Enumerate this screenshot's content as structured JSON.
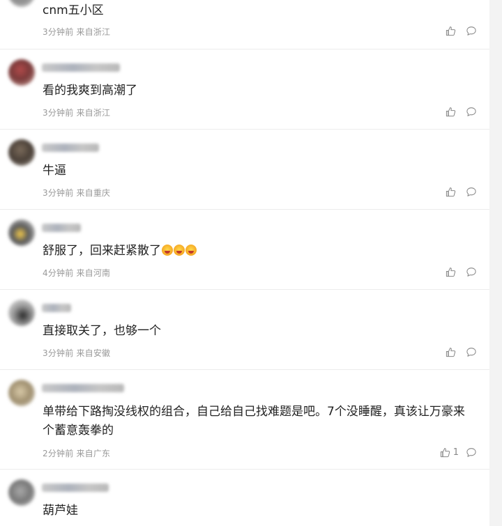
{
  "comments": [
    {
      "text": "cnm五小区",
      "time": "3分钟前",
      "location": "来自浙江",
      "likes": ""
    },
    {
      "text": "看的我爽到高潮了",
      "time": "3分钟前",
      "location": "来自浙江",
      "likes": ""
    },
    {
      "text": "牛逼",
      "time": "3分钟前",
      "location": "来自重庆",
      "likes": ""
    },
    {
      "text": "舒服了，回来赶紧散了",
      "emoji_count": 3,
      "time": "4分钟前",
      "location": "来自河南",
      "likes": ""
    },
    {
      "text": "直接取关了，也够一个",
      "time": "3分钟前",
      "location": "来自安徽",
      "likes": ""
    },
    {
      "text": "单带给下路掏没线权的组合，自己给自己找难题是吧。7个没睡醒，真该让万豪来个蓄意轰拳的",
      "time": "2分钟前",
      "location": "来自广东",
      "likes": "1"
    },
    {
      "text": "葫芦娃",
      "time": "",
      "location": "",
      "likes": ""
    }
  ],
  "icons": {
    "like": "thumbs-up-icon",
    "reply": "speech-bubble-icon",
    "emoji": "crying-laughing-emoji"
  },
  "colors": {
    "text": "#222222",
    "meta": "#999999",
    "divider": "#ececec",
    "icon": "#888888"
  }
}
